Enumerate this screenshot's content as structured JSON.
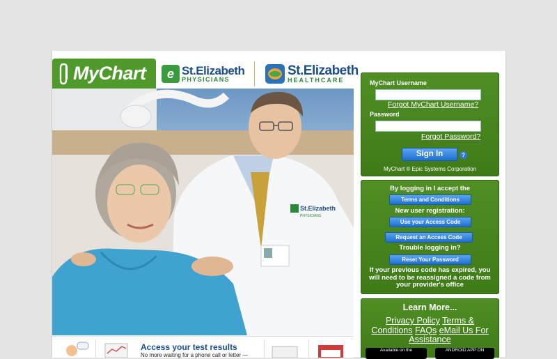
{
  "header": {
    "mychart_logo": "MyChart",
    "physicians_logo": {
      "name": "St.Elizabeth",
      "sub": "PHYSICIANS"
    },
    "healthcare_logo": {
      "name": "St.Elizabeth",
      "sub": "HEALTHCARE"
    }
  },
  "hero": {
    "coat_logo_name": "St.Elizabeth",
    "coat_logo_sub": "PHYSICIANS"
  },
  "login": {
    "username_label": "MyChart Username",
    "forgot_username": "Forgot MyChart Username?",
    "password_label": "Password",
    "forgot_password": "Forgot Password?",
    "signin_label": "Sign In",
    "help": "?",
    "footer": "MyChart ® Epic Systems Corporation"
  },
  "access": {
    "accept_text": "By logging in I accept the",
    "terms_button": "Terms and Conditions",
    "new_user_text": "New user registration:",
    "use_code_button": "Use your Access Code",
    "request_code_button": "Request an Access Code",
    "trouble_text": "Trouble logging in?",
    "reset_button": "Reset Your Password",
    "expired_note": "If your previous code has expired, you will need to be reassigned a code from your provider's office"
  },
  "learn": {
    "heading": "Learn More...",
    "links": [
      "Privacy Policy",
      "Terms & Conditions",
      "FAQs",
      "eMail Us For Assistance"
    ],
    "app_store_badge": "Available on the",
    "android_badge": "ANDROID APP ON"
  },
  "promo": {
    "title": "Access your test results",
    "subtitle": "No more waiting for a phone call or letter —"
  },
  "colors": {
    "brand_green": "#4f9a2b",
    "panel_green": "#3f7a18",
    "button_blue": "#1f6fd0",
    "title_blue": "#1a4f8c"
  }
}
